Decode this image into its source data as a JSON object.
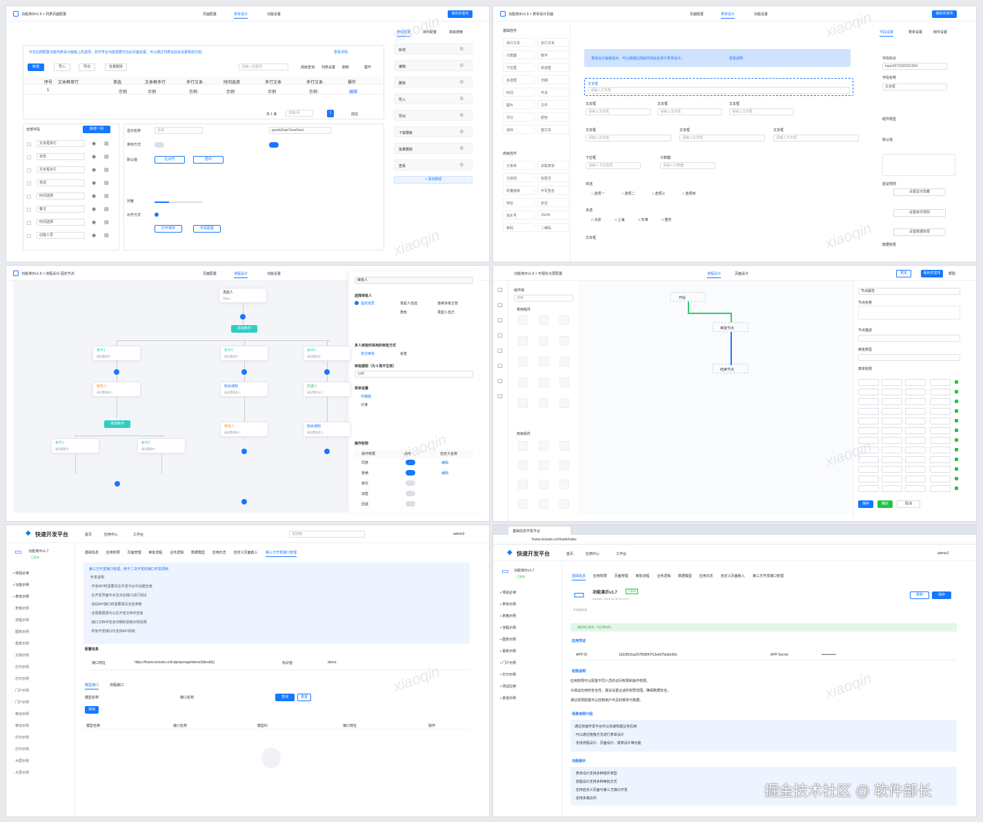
{
  "p1": {
    "title": "功能演示v1.9 > 列表页面配置",
    "tabs": [
      "页面配置",
      "表单设计",
      "功能设置"
    ],
    "save": "保存并发布",
    "notice": "可在右侧配置功能列表设计面板上的选项，如不符合功能需要可在此页面设置，可以通过列表在此处设置相关内容。",
    "notice_link": "查看详情",
    "toolbar": [
      "新增",
      "导入",
      "导出",
      "批量删除"
    ],
    "search_ph": "请输入关键词",
    "tool_right": [
      "高级查询",
      "列表设置",
      "刷新",
      "展开"
    ],
    "cols": [
      "序号",
      "文本框单行",
      "单选",
      "文本框多行",
      "多行文本",
      "时间选择",
      "多行文本",
      "多行文本",
      "操作"
    ],
    "row": [
      "1",
      "示例",
      "示例",
      "示例",
      "示例",
      "示例",
      "示例",
      "示例",
      "编辑"
    ],
    "pager": "共 1 条",
    "pager_size": "20条/页",
    "pager_goto": "前往",
    "pager_page": "1",
    "left_title": "全部字段",
    "add_btn": "新增一列",
    "fields": [
      "文本框单行",
      "状态",
      "文本框多行",
      "单选",
      "时间选择",
      "备注",
      "时间选择",
      "创建人员"
    ],
    "props": [
      "显示名称",
      "排序方式",
      "默认值",
      "列宽",
      "对齐方式"
    ],
    "props_vals": [
      "名称",
      "goodsDateTimeFiled",
      "左对齐",
      "居中"
    ],
    "prop_btn": [
      "打开排序",
      "字段配置"
    ],
    "right_tabs": [
      "按钮配置",
      "排序配置",
      "高级搜索"
    ],
    "right_items": [
      "新增",
      "编辑",
      "删除",
      "导入",
      "导出",
      "下载模板",
      "批量删除",
      "查看"
    ],
    "right_add": "+ 添加按钮"
  },
  "p2": {
    "title": "功能演示v1.9 > 表单设计页面",
    "tabs": [
      "页面配置",
      "表单设计",
      "功能设置"
    ],
    "save": "保存并发布",
    "lg1": "基础控件",
    "comps": [
      "单行文本",
      "多行文本",
      "计数器",
      "数字",
      "下拉框",
      "单选框",
      "多选框",
      "日期",
      "时间",
      "开关",
      "图片",
      "文件",
      "评分",
      "颜色",
      "滑块",
      "富文本"
    ],
    "lg2": "高级控件",
    "comps2": [
      "子表单",
      "关联表单",
      "分割线",
      "标签页",
      "折叠面板",
      "手写签名",
      "地址",
      "定位",
      "流水号",
      "JSON",
      "条码",
      "二维码"
    ],
    "banner": "表单设计面板提示，可以拖拽左侧组件到此处进行表单设计。",
    "banner_link": "查看说明",
    "field_label": "文本框",
    "field_ph": "请输入文本框",
    "f": [
      "文本框",
      "文本框",
      "文本框"
    ],
    "f_ph": "请输入文本框",
    "sel": "下拉框",
    "sel_ph": "请输入下拉选项",
    "num": "计数器",
    "num_ph": "请输入计数器",
    "radio": "单选",
    "radios": [
      "选项一",
      "选项二",
      "选项三",
      "选项四"
    ],
    "check": "多选",
    "checks": [
      "北京",
      "上海",
      "天津",
      "重庆"
    ],
    "last": "文本框",
    "rtabs": [
      "字段设置",
      "表单设置",
      "组件设置"
    ],
    "rp": [
      "字段标识",
      "字段名称",
      "组件类型",
      "默认值",
      "验证规则",
      "数据权限"
    ],
    "rid": "input1673320331394",
    "rval": "文本框",
    "rbtn": [
      "设置显示隐藏",
      "设置条件规则",
      "设置数据权限"
    ]
  },
  "p3": {
    "title": "功能演示v1.9 > 流程设计-固定节点",
    "tabs": [
      "页面配置",
      "流程设计",
      "功能设置"
    ],
    "start": "发起人",
    "start_sub": "所有人",
    "cond1": "添加条件",
    "branches": [
      "条件1",
      "条件2",
      "条件3"
    ],
    "b_sub": "请设置条件",
    "appr": "审批人",
    "appr_sub": "请设置审批人",
    "cc": "抄送人",
    "cc_sub": "请设置抄送人",
    "notify": "知会通知",
    "notify_sub": "请设置知会人",
    "cond2": "添加条件",
    "sub": [
      "条件1",
      "条件2"
    ],
    "rp_title": "审批人",
    "rp": [
      "选择审批人",
      "指定成员",
      "发起人自选",
      "连续多级主管",
      "角色",
      "发起人自己",
      "多人审批时采用的审批方式",
      "依次审批",
      "会签",
      "或签",
      "审批期限（为 0 则不生效）",
      "小时",
      "0",
      "表单设置",
      "可编辑",
      "只读",
      "隐藏",
      "操作权限"
    ],
    "perm_rows": [
      "同意",
      "拒绝",
      "转交",
      "加签",
      "回退"
    ],
    "perm_heads": [
      "操作权限",
      "启用",
      "自定义名称"
    ],
    "edit": "编辑"
  },
  "p4": {
    "title": "功能演示v1.9 > 可视化大屏配置",
    "tabs": [
      "流程设计",
      "页面设计"
    ],
    "btns": [
      "预览",
      "保存并发布",
      "帮助"
    ],
    "left_title": "组件库",
    "search_ph": "搜索",
    "group1": "常用组件",
    "group2": "高级组件",
    "n1": "开始",
    "n2": "审批节点",
    "n3": "结束节点",
    "rp_title": "节点属性",
    "rp_fields": [
      "节点名称",
      "节点描述",
      "审批类型",
      "表单权限"
    ],
    "btn_blue": "保存",
    "btn_green": "确定",
    "btn_cancel": "取消"
  },
  "p5": {
    "brand": "快速开发平台",
    "nav": [
      "首页",
      "应用中心",
      "工作台"
    ],
    "search": "请搜索",
    "user": "admin2",
    "app": "功能演示v1.7",
    "app_status": "已发布",
    "menu": [
      "体验必读",
      "功能示例",
      "表单示例",
      "表格示例",
      "流程示例",
      "图表示例",
      "报表示例",
      "文档示例",
      "打印示例",
      "打印示例",
      "门户示例",
      "门户示例",
      "移动示例",
      "移动示例",
      "打印示例",
      "打印示例",
      "大屏示例",
      "大屏示例"
    ],
    "tabs": [
      "基础信息",
      "应用权限",
      "页面管理",
      "审批流程",
      "业务逻辑",
      "数据模型",
      "应用日志",
      "自定义页面嵌入",
      "第三方开发接口管理"
    ],
    "tip": "第三方开发接口管理，用于二次开发的接口开发调用",
    "tip_body": [
      "开发说明",
      "·开发API时需要先在开发平台中创建应用",
      "·在开发界面中点击对应接口进行测试",
      "·测试API接口时需要填写对应参数",
      "·全局数据源可以在开发文档中查看",
      "·接口文档中包含详细的调用示例说明",
      "·所有开发接口均支持API调用"
    ],
    "sec2": "配置信息",
    "url_label": "接口地址",
    "url": "https://frame.bctools.cn/lcdp/openapi/demo/{identify}",
    "key_label": "标识值",
    "key": "demo",
    "tabs2": [
      "模型接口",
      "流程接口"
    ],
    "f_labels": [
      "模型名称",
      "接口名称"
    ],
    "search_btn": "查询",
    "reset_btn": "重置",
    "add": "添加",
    "table_head": [
      "模型名称",
      "接口名称",
      "模型ID",
      "接口地址",
      "操作"
    ]
  },
  "p6": {
    "tab": "基础信息开发平台",
    "url": "frame.bctools.cn/#/web/index",
    "brand": "快速开发平台",
    "nav": [
      "首页",
      "应用中心",
      "工作台"
    ],
    "user": "admin2",
    "app": "功能演示v1.7",
    "app_status": "已发布",
    "menu": [
      "体验必读",
      "表单示例",
      "表格示例",
      "流程示例",
      "图表示例",
      "报表示例",
      "门户示例",
      "打印示例",
      "测试应用",
      "其他示例"
    ],
    "tabs": [
      "基础信息",
      "应用权限",
      "页面管理",
      "审批流程",
      "业务逻辑",
      "数据模型",
      "应用日志",
      "自定义页面嵌入",
      "第三方开发接口管理"
    ],
    "card_title": "功能演示v1.7",
    "card_status": "已发布",
    "card_sub1": "admin2 | 2024-03-08 15:24:27",
    "card_sub2": "开发者信息",
    "card_btns": [
      "复制",
      "保存"
    ],
    "green": "该应用已发布，可正常访问。",
    "sec1": "应用凭证",
    "appid_l": "APP ID",
    "appid": "1b33f01ba297f69847f13eb07ba6e56e",
    "secret_l": "APP Secret",
    "secret": "••••••••••••",
    "sec2": "权限说明",
    "p2": [
      "应用权限可以配置不同人员的访问权限和操作权限。",
      "为保证应用的安全性，建议设置合适的权限范围，确保数据安全。",
      "通过权限配置可以控制用户可见的菜单与数据。"
    ],
    "sec3": "场景用例介绍",
    "box1": [
      "通过快速开发平台可以快速构建业务应用",
      "·可以通过拖拽方式进行表单设计",
      "·支持流程设计、页面设计、报表设计等功能"
    ],
    "sec4": "功能展示",
    "box2": [
      "·表单设计支持多种组件类型",
      "·流程设计支持多种审批方式",
      "·支持自定义页面与第三方接口开发",
      "·支持多端访问"
    ]
  },
  "footer": "掘金技术社区 @ 软件部长",
  "wm": "xiaoqin"
}
